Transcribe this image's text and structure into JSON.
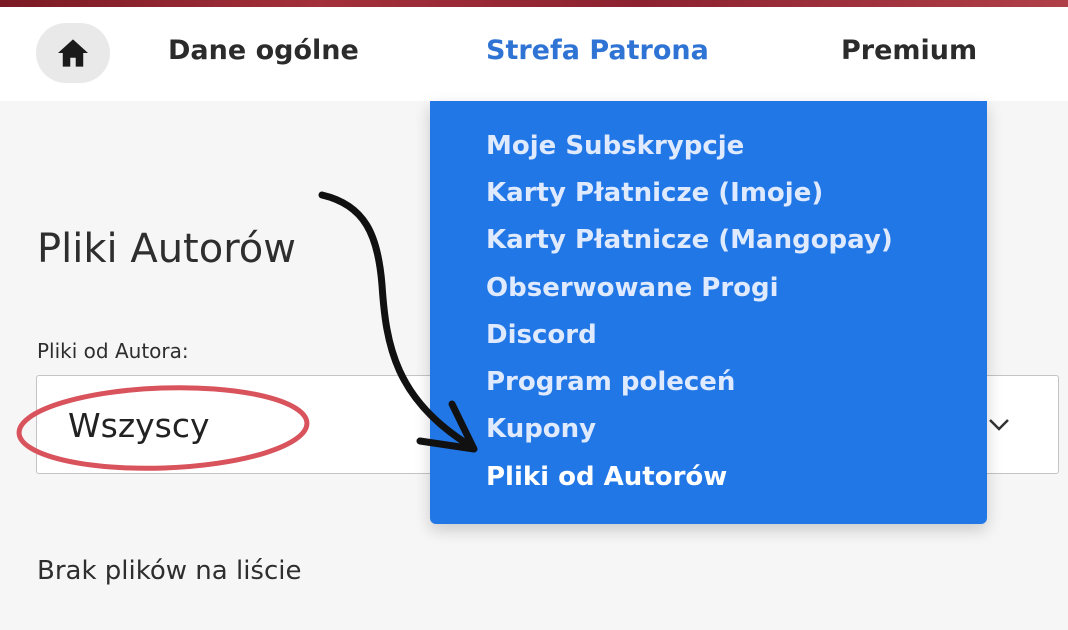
{
  "nav": {
    "home_icon": "home-icon",
    "items": [
      {
        "label": "Dane ogólne"
      },
      {
        "label": "Strefa Patrona"
      },
      {
        "label": "Premium"
      }
    ]
  },
  "dropdown": {
    "items": [
      {
        "label": "Moje Subskrypcje"
      },
      {
        "label": "Karty Płatnicze (Imoje)"
      },
      {
        "label": "Karty Płatnicze (Mangopay)"
      },
      {
        "label": "Obserwowane Progi"
      },
      {
        "label": "Discord"
      },
      {
        "label": "Program poleceń"
      },
      {
        "label": "Kupony"
      },
      {
        "label": "Pliki od Autorów"
      }
    ]
  },
  "main": {
    "title": "Pliki Autorów",
    "filter_label": "Pliki od Autora:",
    "filter_value": "Wszyscy",
    "empty_message": "Brak plików na liście"
  },
  "colors": {
    "accent": "#2277e6",
    "active_nav": "#2f74d4",
    "annotation_circle": "#d9535d",
    "annotation_arrow": "#111111"
  }
}
